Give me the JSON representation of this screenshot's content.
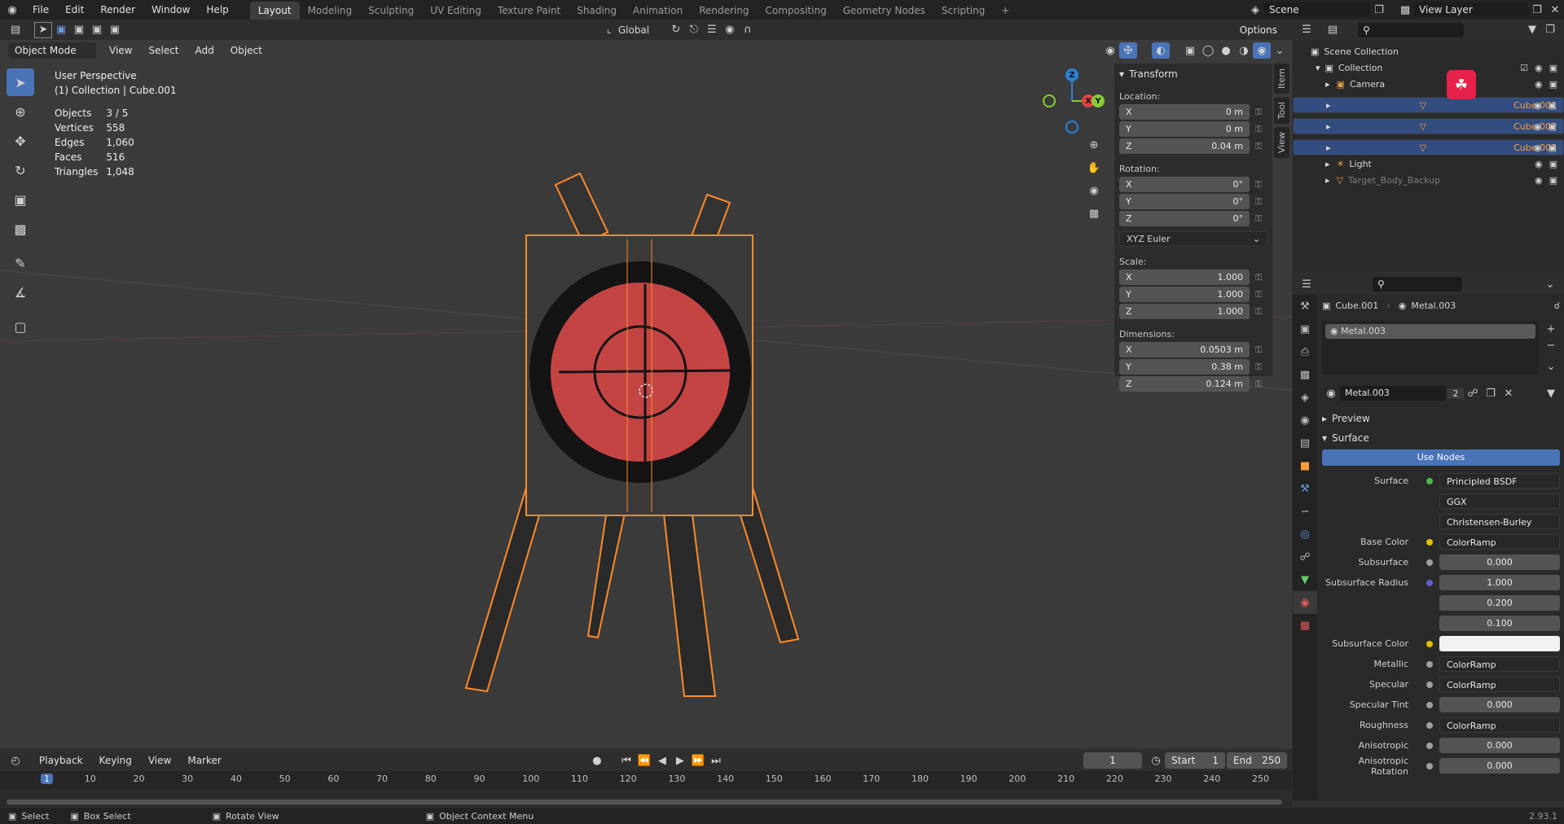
{
  "topbar": {
    "menus": [
      "File",
      "Edit",
      "Render",
      "Window",
      "Help"
    ],
    "workspaces": [
      "Layout",
      "Modeling",
      "Sculpting",
      "UV Editing",
      "Texture Paint",
      "Shading",
      "Animation",
      "Rendering",
      "Compositing",
      "Geometry Nodes",
      "Scripting"
    ],
    "add_tab": "+",
    "scene": "Scene",
    "view_layer": "View Layer"
  },
  "viewheader": {
    "transform_orientation": "Global",
    "options": "Options"
  },
  "viewheader2": {
    "mode": "Object Mode",
    "menus": [
      "View",
      "Select",
      "Add",
      "Object"
    ]
  },
  "overlay": {
    "perspective": "User Perspective",
    "collection": "(1) Collection | Cube.001",
    "stats": [
      {
        "label": "Objects",
        "value": "3 / 5"
      },
      {
        "label": "Vertices",
        "value": "558"
      },
      {
        "label": "Edges",
        "value": "1,060"
      },
      {
        "label": "Faces",
        "value": "516"
      },
      {
        "label": "Triangles",
        "value": "1,048"
      }
    ]
  },
  "gizmo": {
    "x": "X",
    "y": "Y",
    "z": "Z"
  },
  "npanel": {
    "tabs": [
      "Item",
      "Tool",
      "View"
    ],
    "title": "Transform",
    "location_label": "Location:",
    "location": [
      {
        "axis": "X",
        "value": "0 m"
      },
      {
        "axis": "Y",
        "value": "0 m"
      },
      {
        "axis": "Z",
        "value": "0.04 m"
      }
    ],
    "rotation_label": "Rotation:",
    "rotation": [
      {
        "axis": "X",
        "value": "0°"
      },
      {
        "axis": "Y",
        "value": "0°"
      },
      {
        "axis": "Z",
        "value": "0°"
      }
    ],
    "rotation_mode": "XYZ Euler",
    "scale_label": "Scale:",
    "scale": [
      {
        "axis": "X",
        "value": "1.000"
      },
      {
        "axis": "Y",
        "value": "1.000"
      },
      {
        "axis": "Z",
        "value": "1.000"
      }
    ],
    "dimensions_label": "Dimensions:",
    "dimensions": [
      {
        "axis": "X",
        "value": "0.0503 m"
      },
      {
        "axis": "Y",
        "value": "0.38 m"
      },
      {
        "axis": "Z",
        "value": "0.124 m"
      }
    ]
  },
  "outliner": {
    "scene_collection": "Scene Collection",
    "collection": "Collection",
    "items": [
      {
        "name": "Camera",
        "style": "normal",
        "selected": false
      },
      {
        "name": "Cube.001",
        "style": "or",
        "selected": true
      },
      {
        "name": "Cube.002",
        "style": "or",
        "selected": true
      },
      {
        "name": "Cube.003",
        "style": "or",
        "selected": true
      },
      {
        "name": "Light",
        "style": "normal",
        "selected": false
      },
      {
        "name": "Target_Body_Backup",
        "style": "dim",
        "selected": false
      }
    ]
  },
  "properties": {
    "object": "Cube.001",
    "material": "Metal.003",
    "slot": "Metal.003",
    "material_field": "Metal.003",
    "users": "2",
    "preview": "Preview",
    "surface": "Surface",
    "use_nodes": "Use Nodes",
    "rows": [
      {
        "label": "Surface",
        "value": "Principled BSDF",
        "dot": "#4cb84c",
        "kind": "dark"
      },
      {
        "label": "",
        "value": "GGX",
        "dot": "",
        "kind": "select"
      },
      {
        "label": "",
        "value": "Christensen-Burley",
        "dot": "",
        "kind": "select"
      },
      {
        "label": "Base Color",
        "value": "ColorRamp",
        "dot": "#e0c000",
        "kind": "dark"
      },
      {
        "label": "Subsurface",
        "value": "0.000",
        "dot": "#a0a0a0",
        "kind": "num"
      },
      {
        "label": "Subsurface Radius",
        "value": "1.000",
        "dot": "#6060c8",
        "kind": "num"
      },
      {
        "label": "",
        "value": "0.200",
        "dot": "",
        "kind": "num"
      },
      {
        "label": "",
        "value": "0.100",
        "dot": "",
        "kind": "num"
      },
      {
        "label": "Subsurface Color",
        "value": "",
        "dot": "#e0c000",
        "kind": "white"
      },
      {
        "label": "Metallic",
        "value": "ColorRamp",
        "dot": "#a0a0a0",
        "kind": "dark"
      },
      {
        "label": "Specular",
        "value": "ColorRamp",
        "dot": "#a0a0a0",
        "kind": "dark"
      },
      {
        "label": "Specular Tint",
        "value": "0.000",
        "dot": "#a0a0a0",
        "kind": "num"
      },
      {
        "label": "Roughness",
        "value": "ColorRamp",
        "dot": "#a0a0a0",
        "kind": "dark"
      },
      {
        "label": "Anisotropic",
        "value": "0.000",
        "dot": "#a0a0a0",
        "kind": "num"
      },
      {
        "label": "Anisotropic Rotation",
        "value": "0.000",
        "dot": "#a0a0a0",
        "kind": "num"
      }
    ]
  },
  "timeline": {
    "menus": [
      "Playback",
      "Keying",
      "View",
      "Marker"
    ],
    "current_frame": "1",
    "start_label": "Start",
    "start": "1",
    "end_label": "End",
    "end": "250",
    "ticks": [
      "1",
      "10",
      "20",
      "30",
      "40",
      "50",
      "60",
      "70",
      "80",
      "90",
      "100",
      "110",
      "120",
      "130",
      "140",
      "150",
      "160",
      "170",
      "180",
      "190",
      "200",
      "210",
      "220",
      "230",
      "240",
      "250"
    ]
  },
  "status": {
    "select": "Select",
    "box_select": "Box Select",
    "rotate_view": "Rotate View",
    "context_menu": "Object Context Menu",
    "version": "2.93.1"
  },
  "colors": {
    "accent": "#4a74b8",
    "selection": "#ff8a2a",
    "header": "#232323"
  }
}
